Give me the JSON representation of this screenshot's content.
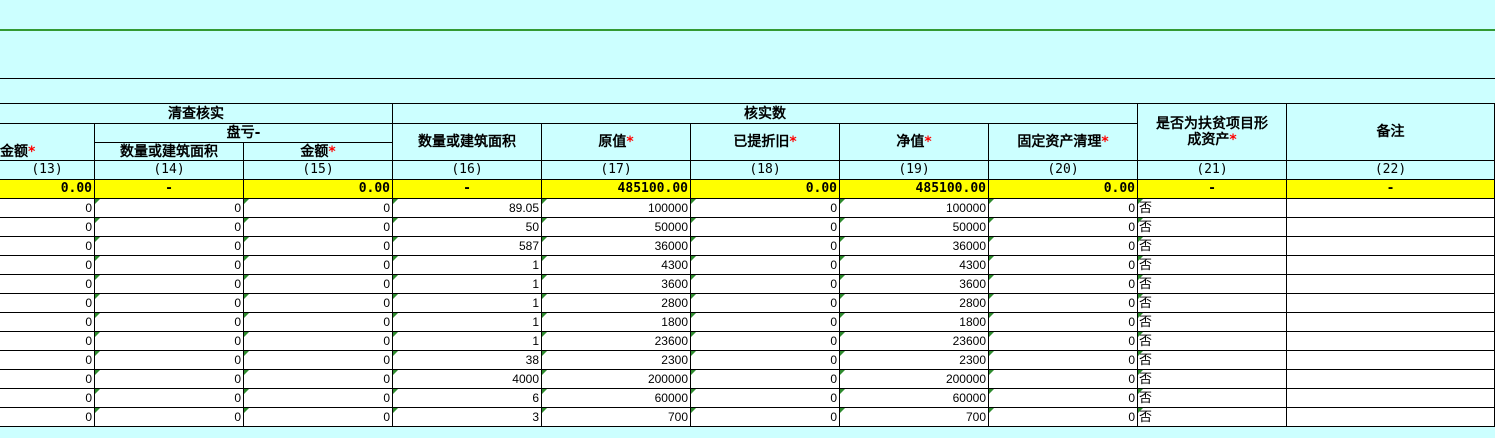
{
  "header": {
    "group_qingcha": "清查核实",
    "group_hesheshu": "核实数",
    "sub_pankui": "盘亏-",
    "col_13": "金额",
    "col_14": "数量或建筑面积",
    "col_15": "金额",
    "col_16": "数量或建筑面积",
    "col_17": "原值",
    "col_18": "已提折旧",
    "col_19": "净值",
    "col_20": "固定资产清理",
    "col_21_line1": "是否为扶贫项目形",
    "col_21_line2": "成资产",
    "col_22": "备注",
    "required_mark": "*"
  },
  "col_numbers": [
    "(13)",
    "(14)",
    "(15)",
    "(16)",
    "(17)",
    "(18)",
    "(19)",
    "(20)",
    "(21)",
    "(22)"
  ],
  "totals": [
    "0.00",
    "-",
    "0.00",
    "-",
    "485100.00",
    "0.00",
    "485100.00",
    "0.00",
    "-",
    "-"
  ],
  "rows": [
    [
      "0",
      "0",
      "0",
      "89.05",
      "100000",
      "0",
      "100000",
      "0",
      "否",
      ""
    ],
    [
      "0",
      "0",
      "0",
      "50",
      "50000",
      "0",
      "50000",
      "0",
      "否",
      ""
    ],
    [
      "0",
      "0",
      "0",
      "587",
      "36000",
      "0",
      "36000",
      "0",
      "否",
      ""
    ],
    [
      "0",
      "0",
      "0",
      "1",
      "4300",
      "0",
      "4300",
      "0",
      "否",
      ""
    ],
    [
      "0",
      "0",
      "0",
      "1",
      "3600",
      "0",
      "3600",
      "0",
      "否",
      ""
    ],
    [
      "0",
      "0",
      "0",
      "1",
      "2800",
      "0",
      "2800",
      "0",
      "否",
      ""
    ],
    [
      "0",
      "0",
      "0",
      "1",
      "1800",
      "0",
      "1800",
      "0",
      "否",
      ""
    ],
    [
      "0",
      "0",
      "0",
      "1",
      "23600",
      "0",
      "23600",
      "0",
      "否",
      ""
    ],
    [
      "0",
      "0",
      "0",
      "38",
      "2300",
      "0",
      "2300",
      "0",
      "否",
      ""
    ],
    [
      "0",
      "0",
      "0",
      "4000",
      "200000",
      "0",
      "200000",
      "0",
      "否",
      ""
    ],
    [
      "0",
      "0",
      "0",
      "6",
      "60000",
      "0",
      "60000",
      "0",
      "否",
      ""
    ],
    [
      "0",
      "0",
      "0",
      "3",
      "700",
      "0",
      "700",
      "0",
      "否",
      ""
    ]
  ]
}
